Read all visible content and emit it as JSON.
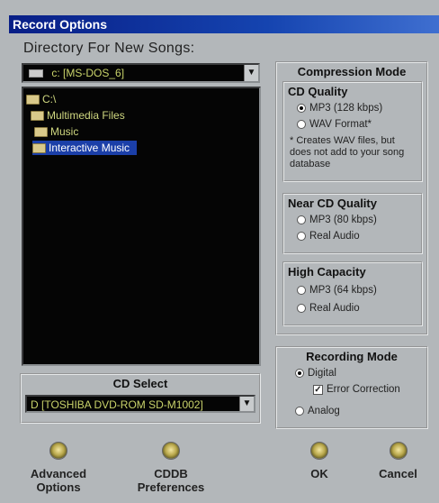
{
  "window": {
    "title": "Record Options"
  },
  "directory": {
    "label": "Directory For New Songs:",
    "drive_value": "c: [MS-DOS_6]",
    "tree": [
      {
        "label": "C:\\",
        "selected": false
      },
      {
        "label": "Multimedia Files",
        "selected": false
      },
      {
        "label": "Music",
        "selected": false
      },
      {
        "label": "Interactive Music",
        "selected": true
      }
    ]
  },
  "cd_select": {
    "title": "CD Select",
    "value": "D  [TOSHIBA DVD-ROM SD-M1002]"
  },
  "compression": {
    "title": "Compression Mode",
    "cd_quality": {
      "title": "CD Quality",
      "options": [
        {
          "label": "MP3  (128 kbps)",
          "checked": true
        },
        {
          "label": "WAV Format*",
          "checked": false
        }
      ],
      "note": "* Creates WAV files, but does not add to your song database"
    },
    "near_cd": {
      "title": "Near CD Quality",
      "options": [
        {
          "label": "MP3  (80 kbps)",
          "checked": false
        },
        {
          "label": "Real Audio",
          "checked": false
        }
      ]
    },
    "high_capacity": {
      "title": "High Capacity",
      "options": [
        {
          "label": "MP3  (64 kbps)",
          "checked": false
        },
        {
          "label": "Real Audio",
          "checked": false
        }
      ]
    }
  },
  "recording": {
    "title": "Recording Mode",
    "digital": {
      "label": "Digital",
      "checked": true
    },
    "error_correction": {
      "label": "Error Correction",
      "checked": true,
      "mark": "✓"
    },
    "analog": {
      "label": "Analog",
      "checked": false
    }
  },
  "buttons": {
    "advanced_line1": "Advanced",
    "advanced_line2": "Options",
    "cddb_line1": "CDDB",
    "cddb_line2": "Preferences",
    "ok": "OK",
    "cancel": "Cancel"
  },
  "icons": {
    "dropdown_arrow": "▼"
  },
  "colors": {
    "titlebar": "#081e86",
    "tree_selection": "#1b3fa8",
    "tree_text": "#d0d880"
  }
}
